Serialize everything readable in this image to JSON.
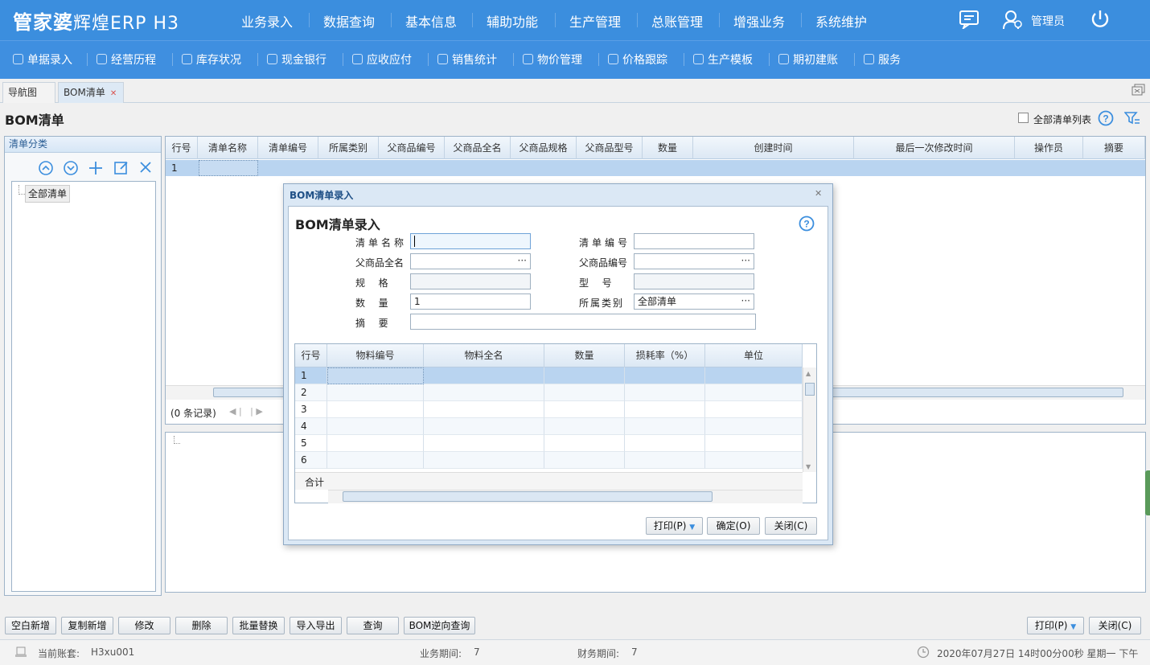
{
  "app": {
    "logo": "管家婆",
    "logo_sub": "辉煌ERP H3",
    "user": "管理员"
  },
  "top_menu": [
    "业务录入",
    "数据查询",
    "基本信息",
    "辅助功能",
    "生产管理",
    "总账管理",
    "增强业务",
    "系统维护"
  ],
  "toolbar": [
    "单据录入",
    "经营历程",
    "库存状况",
    "现金银行",
    "应收应付",
    "销售统计",
    "物价管理",
    "价格跟踪",
    "生产模板",
    "期初建账",
    "服务"
  ],
  "tabs": [
    "导航图",
    "BOM清单"
  ],
  "page": {
    "title": "BOM清单",
    "all_list_label": "全部清单列表"
  },
  "category": {
    "header": "清单分类",
    "root": "全部清单"
  },
  "grid": {
    "columns": [
      "行号",
      "清单名称",
      "清单编号",
      "所属类别",
      "父商品编号",
      "父商品全名",
      "父商品规格",
      "父商品型号",
      "数量",
      "创建时间",
      "最后一次修改时间",
      "操作员",
      "摘要"
    ],
    "rows": [
      [
        "1",
        "",
        "",
        "",
        "",
        "",
        "",
        "",
        "",
        "",
        "",
        "",
        ""
      ]
    ],
    "records": "(0 条记录)"
  },
  "dialog": {
    "window_title": "BOM清单录入",
    "heading": "BOM清单录入",
    "labels": {
      "name": "清单名称",
      "code": "清单编号",
      "parent_name": "父商品全名",
      "parent_code": "父商品编号",
      "spec": "规  格",
      "model": "型  号",
      "qty": "数  量",
      "category": "所属类别",
      "memo": "摘  要"
    },
    "values": {
      "name": "",
      "code": "",
      "parent_name": "",
      "parent_code": "",
      "spec": "",
      "model": "",
      "qty": "1",
      "category": "全部清单",
      "memo": ""
    },
    "detail_columns": [
      "行号",
      "物料编号",
      "物料全名",
      "数量",
      "损耗率（%）",
      "单位"
    ],
    "detail_rows": [
      "1",
      "2",
      "3",
      "4",
      "5",
      "6"
    ],
    "total_label": "合计",
    "buttons": {
      "print": "打印(P)",
      "ok": "确定(O)",
      "close": "关闭(C)"
    }
  },
  "bottom_buttons": [
    "空白新增",
    "复制新增",
    "修改",
    "删除",
    "批量替换",
    "导入导出",
    "查询",
    "BOM逆向查询"
  ],
  "bottom_right": {
    "print": "打印(P)",
    "close": "关闭(C)"
  },
  "status": {
    "account_label": "当前账套:",
    "account": "H3xu001",
    "period_label": "业务期间:",
    "period": "7",
    "fin_label": "财务期间:",
    "fin": "7",
    "datetime": "2020年07月27日 14时00分00秒 星期一 下午"
  },
  "colors": {
    "top": "#3b8ede",
    "toolbar": "#3f8fe0",
    "selected_row": "#b9d4f0",
    "header_bg": "#e4eef8"
  }
}
